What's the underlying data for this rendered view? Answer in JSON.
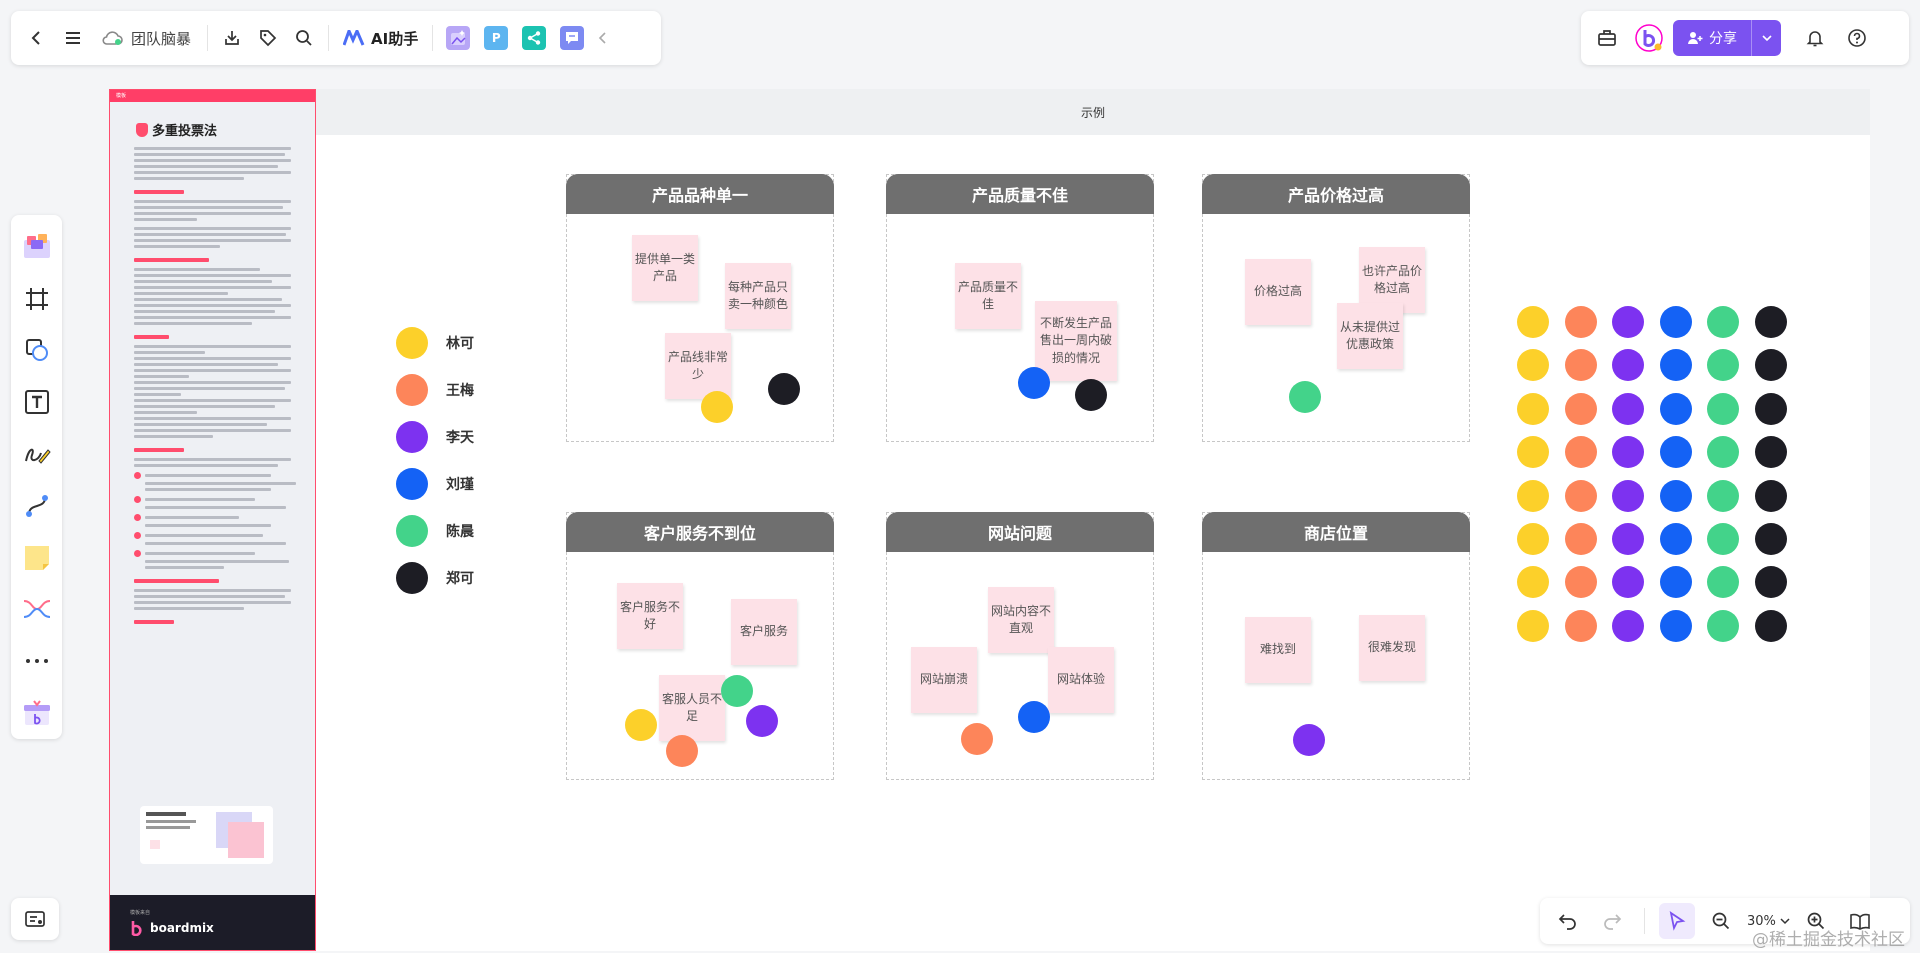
{
  "topbar": {
    "title": "团队脑暴",
    "ai_label": "AI助手"
  },
  "topright": {
    "share_label": "分享"
  },
  "zoom": {
    "value": "30%"
  },
  "watermark": "@稀土掘金技术社区",
  "colors": {
    "yellow": "#fcd02a",
    "orange": "#fd855a",
    "purple": "#7d32f0",
    "blue": "#1462f5",
    "green": "#43d38a",
    "black": "#1d1d24",
    "accent": "#7b52f0",
    "brand_red": "#ff4d6d"
  },
  "panel": {
    "strip_label": "模板",
    "title": "多重投票法",
    "footer_small": "模板来自",
    "footer_brand": "boardmix"
  },
  "frame": {
    "title": "示例"
  },
  "legend": [
    {
      "name": "林可",
      "color": "yellow"
    },
    {
      "name": "王梅",
      "color": "orange"
    },
    {
      "name": "李天",
      "color": "purple"
    },
    {
      "name": "刘瑾",
      "color": "blue"
    },
    {
      "name": "陈晨",
      "color": "green"
    },
    {
      "name": "郑可",
      "color": "black"
    }
  ],
  "cards": [
    {
      "title": "产品品种单一",
      "notes": [
        "提供单一类产品",
        "每种产品只卖一种颜色",
        "产品线非常少"
      ],
      "votes": [
        "yellow",
        "black"
      ]
    },
    {
      "title": "产品质量不佳",
      "notes": [
        "产品质量不佳",
        "不断发生产品售出一周内破损的情况"
      ],
      "votes": [
        "blue",
        "black"
      ]
    },
    {
      "title": "产品价格过高",
      "notes": [
        "价格过高",
        "也许产品价格过高",
        "从未提供过优惠政策"
      ],
      "votes": [
        "green"
      ]
    },
    {
      "title": "客户服务不到位",
      "notes": [
        "客户服务不好",
        "客户服务",
        "客服人员不足"
      ],
      "votes": [
        "yellow",
        "orange",
        "green",
        "purple"
      ]
    },
    {
      "title": "网站问题",
      "notes": [
        "网站内容不直观",
        "网站崩溃",
        "网站体验"
      ],
      "votes": [
        "orange",
        "blue"
      ]
    },
    {
      "title": "商店位置",
      "notes": [
        "难找到",
        "很难发现"
      ],
      "votes": [
        "purple"
      ]
    }
  ],
  "dot_grid": {
    "rows": 8,
    "columns": [
      "yellow",
      "orange",
      "purple",
      "blue",
      "green",
      "black"
    ]
  }
}
